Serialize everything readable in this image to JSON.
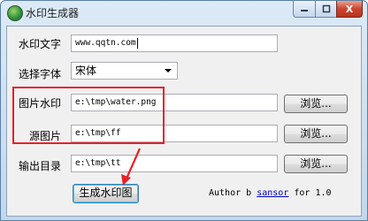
{
  "window": {
    "title": "水印生成器",
    "close_glyph": "X"
  },
  "form": {
    "watermark_text": {
      "label": "水印文字",
      "value": "www.qqtn.com"
    },
    "font": {
      "label": "选择字体",
      "value": "宋体"
    },
    "image_watermark": {
      "label": "图片水印",
      "value": "e:\\tmp\\water.png",
      "browse_label": "浏览..."
    },
    "source_image": {
      "label": "源图片",
      "value": "e:\\tmp\\ff",
      "browse_label": "浏览..."
    },
    "output_dir": {
      "label": "输出目录",
      "value": "e:\\tmp\\tt",
      "browse_label": "浏览..."
    }
  },
  "generate_button_label": "生成水印图",
  "author": {
    "prefix": "Author b",
    "link": "sansor",
    "suffix": "for 1.0"
  },
  "colors": {
    "highlight": "#e8202a",
    "link": "#0000cc"
  }
}
